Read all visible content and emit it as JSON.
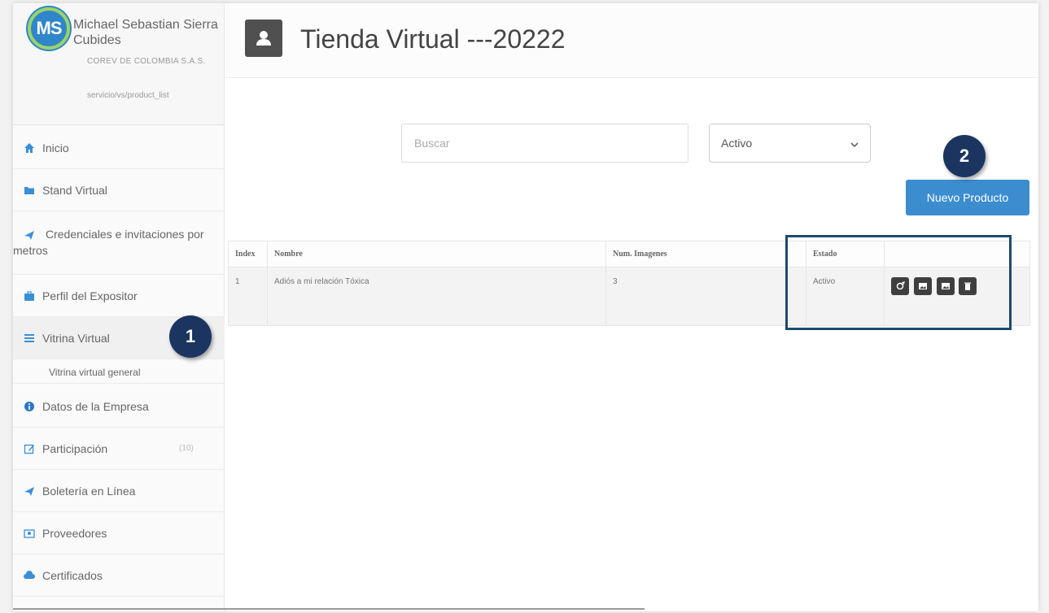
{
  "profile": {
    "initials": "MS",
    "name": "Michael Sebastian Sierra Cubides",
    "company": "COREV DE COLOMBIA S.A.S.",
    "path": "servicio/vs/product_list"
  },
  "sidebar": {
    "items": [
      {
        "label": "Inicio",
        "icon": "home-icon"
      },
      {
        "label": "Stand Virtual",
        "icon": "folder-icon"
      },
      {
        "label": "Credenciales e invitaciones por metros",
        "icon": "plane-icon"
      },
      {
        "label": "Perfil del Expositor",
        "icon": "briefcase-icon"
      },
      {
        "label": "Vitrina Virtual",
        "icon": "list-icon"
      },
      {
        "label": "Datos de la Empresa",
        "icon": "info-icon"
      },
      {
        "label": "Participación",
        "icon": "edit-icon",
        "count": "(10)"
      },
      {
        "label": "Boletería en Línea",
        "icon": "plane-icon"
      },
      {
        "label": "Proveedores",
        "icon": "id-card-icon"
      },
      {
        "label": "Certificados",
        "icon": "cloud-icon"
      }
    ],
    "submenu": "Vitrina virtual general"
  },
  "header": {
    "title": "Tienda Virtual ---20222"
  },
  "search": {
    "placeholder": "Buscar"
  },
  "status_filter": {
    "selected": "Activo"
  },
  "new_product_label": "Nuevo Producto",
  "table": {
    "headers": [
      "Index",
      "Nombre",
      "Num. Imagenes",
      "Estado",
      ""
    ],
    "rows": [
      {
        "index": "1",
        "nombre": "Adiós a mi relación Tóxica",
        "imagenes": "3",
        "estado": "Activo"
      }
    ]
  },
  "callouts": [
    "1",
    "2"
  ],
  "colors": {
    "primary": "#3c8dd0",
    "callout": "#1b3560",
    "dark_button": "#3f3f3f"
  }
}
